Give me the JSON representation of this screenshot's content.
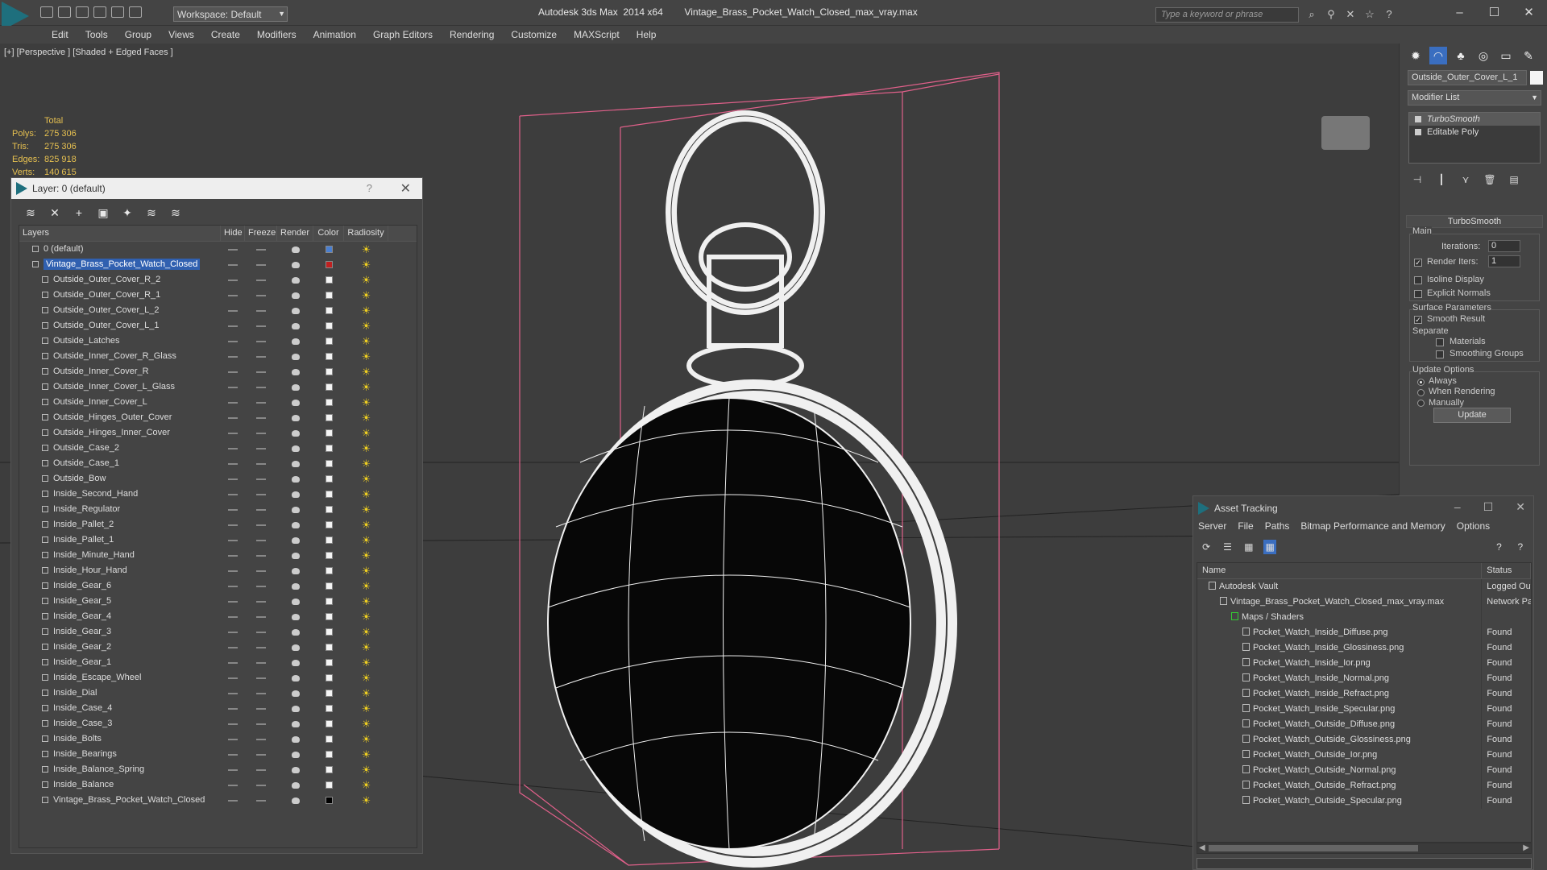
{
  "app": {
    "title_left": "Autodesk 3ds Max  2014 x64",
    "title_right": "Vintage_Brass_Pocket_Watch_Closed_max_vray.max",
    "workspace": "Workspace: Default",
    "search_placeholder": "Type a keyword or phrase"
  },
  "menu": [
    "Edit",
    "Tools",
    "Group",
    "Views",
    "Create",
    "Modifiers",
    "Animation",
    "Graph Editors",
    "Rendering",
    "Customize",
    "MAXScript",
    "Help"
  ],
  "viewport": {
    "label": "[+] [Perspective ] [Shaded + Edged Faces ]",
    "stats": {
      "header": "Total",
      "rows": [
        {
          "k": "Polys:",
          "v": "275 306"
        },
        {
          "k": "Tris:",
          "v": "275 306"
        },
        {
          "k": "Edges:",
          "v": "825 918"
        },
        {
          "k": "Verts:",
          "v": "140 615"
        }
      ]
    }
  },
  "layer_dialog": {
    "title": "Layer: 0 (default)",
    "columns": [
      "Layers",
      "Hide",
      "Freeze",
      "Render",
      "Color",
      "Radiosity"
    ],
    "root_layers": [
      {
        "name": "0 (default)",
        "color": "#4a7fd0"
      },
      {
        "name": "Vintage_Brass_Pocket_Watch_Closed",
        "color": "#c02020"
      }
    ],
    "objects": [
      "Outside_Outer_Cover_R_2",
      "Outside_Outer_Cover_R_1",
      "Outside_Outer_Cover_L_2",
      "Outside_Outer_Cover_L_1",
      "Outside_Latches",
      "Outside_Inner_Cover_R_Glass",
      "Outside_Inner_Cover_R",
      "Outside_Inner_Cover_L_Glass",
      "Outside_Inner_Cover_L",
      "Outside_Hinges_Outer_Cover",
      "Outside_Hinges_Inner_Cover",
      "Outside_Case_2",
      "Outside_Case_1",
      "Outside_Bow",
      "Inside_Second_Hand",
      "Inside_Regulator",
      "Inside_Pallet_2",
      "Inside_Pallet_1",
      "Inside_Minute_Hand",
      "Inside_Hour_Hand",
      "Inside_Gear_6",
      "Inside_Gear_5",
      "Inside_Gear_4",
      "Inside_Gear_3",
      "Inside_Gear_2",
      "Inside_Gear_1",
      "Inside_Escape_Wheel",
      "Inside_Dial",
      "Inside_Case_4",
      "Inside_Case_3",
      "Inside_Bolts",
      "Inside_Bearings",
      "Inside_Balance_Spring",
      "Inside_Balance",
      "Vintage_Brass_Pocket_Watch_Closed"
    ]
  },
  "command_panel": {
    "object_name": "Outside_Outer_Cover_L_1",
    "modifier_list": "Modifier List",
    "stack": [
      "TurboSmooth",
      "Editable Poly"
    ],
    "rollout_title": "TurboSmooth",
    "main_label": "Main",
    "iterations_label": "Iterations:",
    "iterations_value": "0",
    "render_iters_label": "Render Iters:",
    "render_iters_value": "1",
    "isoline_label": "Isoline Display",
    "explicit_label": "Explicit Normals",
    "surface_label": "Surface Parameters",
    "smooth_label": "Smooth Result",
    "separate_label": "Separate",
    "materials_label": "Materials",
    "smoothing_label": "Smoothing Groups",
    "update_options_label": "Update Options",
    "always_label": "Always",
    "when_rendering_label": "When Rendering",
    "manually_label": "Manually",
    "update_button": "Update"
  },
  "asset_dialog": {
    "title": "Asset Tracking",
    "menu": [
      "Server",
      "File",
      "Paths",
      "Bitmap Performance and Memory",
      "Options"
    ],
    "columns": [
      "Name",
      "Status"
    ],
    "rows": [
      {
        "name": "Autodesk Vault",
        "status": "Logged Out",
        "indent": 1
      },
      {
        "name": "Vintage_Brass_Pocket_Watch_Closed_max_vray.max",
        "status": "Network Path",
        "indent": 2
      },
      {
        "name": "Maps / Shaders",
        "status": "",
        "indent": 3
      },
      {
        "name": "Pocket_Watch_Inside_Diffuse.png",
        "status": "Found",
        "indent": 4
      },
      {
        "name": "Pocket_Watch_Inside_Glossiness.png",
        "status": "Found",
        "indent": 4
      },
      {
        "name": "Pocket_Watch_Inside_Ior.png",
        "status": "Found",
        "indent": 4
      },
      {
        "name": "Pocket_Watch_Inside_Normal.png",
        "status": "Found",
        "indent": 4
      },
      {
        "name": "Pocket_Watch_Inside_Refract.png",
        "status": "Found",
        "indent": 4
      },
      {
        "name": "Pocket_Watch_Inside_Specular.png",
        "status": "Found",
        "indent": 4
      },
      {
        "name": "Pocket_Watch_Outside_Diffuse.png",
        "status": "Found",
        "indent": 4
      },
      {
        "name": "Pocket_Watch_Outside_Glossiness.png",
        "status": "Found",
        "indent": 4
      },
      {
        "name": "Pocket_Watch_Outside_Ior.png",
        "status": "Found",
        "indent": 4
      },
      {
        "name": "Pocket_Watch_Outside_Normal.png",
        "status": "Found",
        "indent": 4
      },
      {
        "name": "Pocket_Watch_Outside_Refract.png",
        "status": "Found",
        "indent": 4
      },
      {
        "name": "Pocket_Watch_Outside_Specular.png",
        "status": "Found",
        "indent": 4
      }
    ]
  },
  "colors": {
    "accent": "#3a6ec0",
    "stats": "#e6c050",
    "bbox": "#e0608a",
    "wire": "#f0f0f0"
  },
  "icons": [
    "app-logo-icon",
    "new-file-icon",
    "open-file-icon",
    "save-icon",
    "undo-icon",
    "redo-icon",
    "help-icon",
    "close-icon",
    "radiosity-sun-icon",
    "teapot-icon"
  ]
}
